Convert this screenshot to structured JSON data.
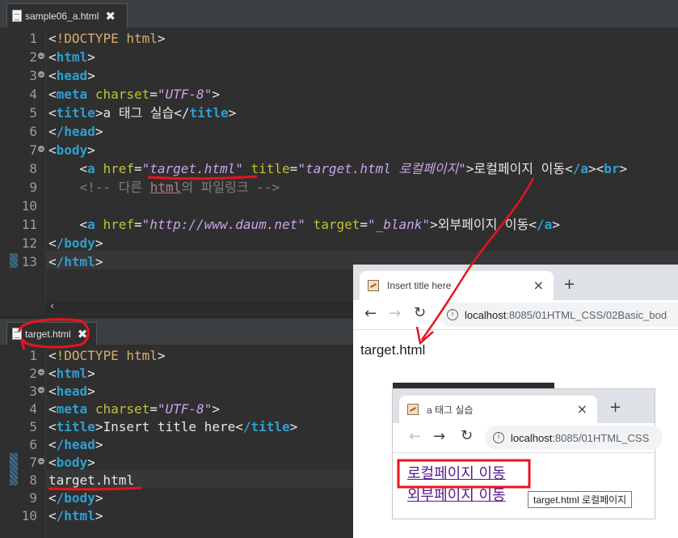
{
  "editor_top": {
    "tab_filename": "sample06_a.html",
    "close_glyph": "✖",
    "lines": [
      {
        "n": "1",
        "fold": false
      },
      {
        "n": "2",
        "fold": true
      },
      {
        "n": "3",
        "fold": true
      },
      {
        "n": "4",
        "fold": false
      },
      {
        "n": "5",
        "fold": false
      },
      {
        "n": "6",
        "fold": false
      },
      {
        "n": "7",
        "fold": true
      },
      {
        "n": "8",
        "fold": false
      },
      {
        "n": "9",
        "fold": false
      },
      {
        "n": "10",
        "fold": false
      },
      {
        "n": "11",
        "fold": false
      },
      {
        "n": "12",
        "fold": false
      },
      {
        "n": "13",
        "fold": false
      }
    ],
    "code": {
      "l1_doctype": "!DOCTYPE",
      "l1_html": "html",
      "l2_tag": "html",
      "l3_tag": "head",
      "l4_tag": "meta",
      "l4_attr": "charset",
      "l4_val": "\"UTF-8\"",
      "l5_tag": "title",
      "l5_text": "a 태그 실습",
      "l6_tag": "/head",
      "l7_tag": "body",
      "l8_tag": "a",
      "l8_attr1": "href",
      "l8_val1": "\"target.html\"",
      "l8_attr2": "title",
      "l8_val2": "\"target.html 로컬페이지\"",
      "l8_text": "로컬페이지 이동",
      "l8_close": "/a",
      "l8_br": "br",
      "l9_comment_a": "<!-- 다른 ",
      "l9_comment_b": "html",
      "l9_comment_c": "의 파일링크 -->",
      "l11_tag": "a",
      "l11_attr1": "href",
      "l11_val1": "\"http://www.daum.net\"",
      "l11_attr2": "target",
      "l11_val2": "\"_blank\"",
      "l11_text": "외부페이지 이동",
      "l11_close": "/a",
      "l12_tag": "/body",
      "l13_tag": "/html"
    },
    "scroll_arrow": "‹"
  },
  "editor_bottom": {
    "tab_filename": "target.html",
    "close_glyph": "✖",
    "lines": [
      {
        "n": "1",
        "fold": false
      },
      {
        "n": "2",
        "fold": true
      },
      {
        "n": "3",
        "fold": true
      },
      {
        "n": "4",
        "fold": false
      },
      {
        "n": "5",
        "fold": false
      },
      {
        "n": "6",
        "fold": false
      },
      {
        "n": "7",
        "fold": true
      },
      {
        "n": "8",
        "fold": false
      },
      {
        "n": "9",
        "fold": false
      },
      {
        "n": "10",
        "fold": false
      }
    ],
    "code": {
      "l1_doctype": "!DOCTYPE",
      "l1_html": "html",
      "l2_tag": "html",
      "l3_tag": "head",
      "l4_tag": "meta",
      "l4_attr": "charset",
      "l4_val": "\"UTF-8\"",
      "l5_tag": "title",
      "l5_text": "Insert title here",
      "l5_close": "/title",
      "l6_tag": "/head",
      "l7_tag": "body",
      "l8_text": "target.html",
      "l9_tag": "/body",
      "l10_tag": "/html"
    }
  },
  "browser_target": {
    "tab_title": "Insert title here",
    "tab_close": "×",
    "new_tab": "+",
    "back": "←",
    "forward": "→",
    "reload": "↻",
    "info": "i",
    "url_host": "localhost",
    "url_path": ":8085/01HTML_CSS/02Basic_bod",
    "page_text": "target.html"
  },
  "browser_source": {
    "tab_title": "a 태그 실습",
    "tab_close": "×",
    "new_tab": "+",
    "back": "←",
    "forward": "→",
    "reload": "↻",
    "info": "i",
    "url_host": "localhost",
    "url_path": ":8085/01HTML_CSS",
    "link_local": "로컬페이지 이동",
    "link_external": "외부페이지 이동",
    "tooltip": "target.html 로컬페이지"
  },
  "colors": {
    "tag": "#2e9fd0",
    "attribute": "#bfc23a",
    "value": "#c9a3e8",
    "annotation_red": "#e8141e"
  }
}
